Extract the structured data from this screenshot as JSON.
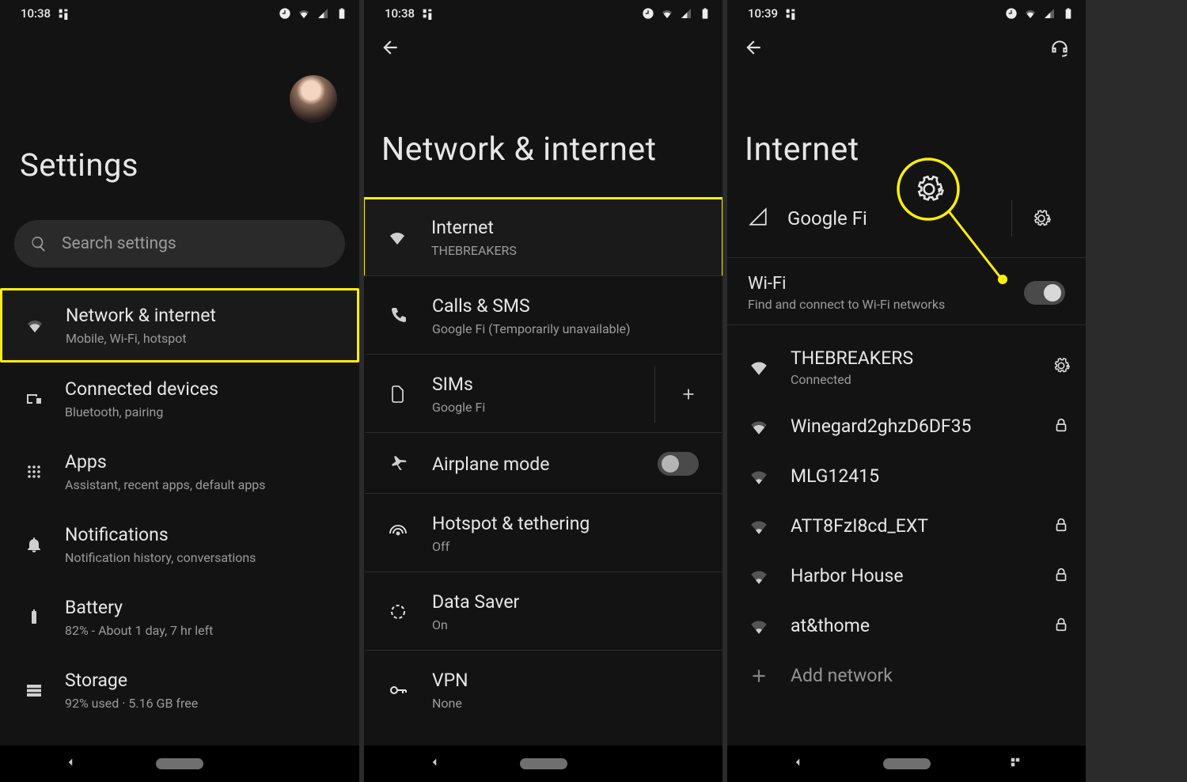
{
  "statusbar1": {
    "time": "10:38"
  },
  "statusbar2": {
    "time": "10:38"
  },
  "statusbar3": {
    "time": "10:39"
  },
  "panel1": {
    "title": "Settings",
    "search_placeholder": "Search settings",
    "items": [
      {
        "title": "Network & internet",
        "sub": "Mobile, Wi-Fi, hotspot"
      },
      {
        "title": "Connected devices",
        "sub": "Bluetooth, pairing"
      },
      {
        "title": "Apps",
        "sub": "Assistant, recent apps, default apps"
      },
      {
        "title": "Notifications",
        "sub": "Notification history, conversations"
      },
      {
        "title": "Battery",
        "sub": "82% - About 1 day, 7 hr left"
      },
      {
        "title": "Storage",
        "sub": "92% used · 5.16 GB free"
      }
    ]
  },
  "panel2": {
    "title": "Network & internet",
    "items": [
      {
        "title": "Internet",
        "sub": "THEBREAKERS"
      },
      {
        "title": "Calls & SMS",
        "sub": "Google Fi (Temporarily unavailable)"
      },
      {
        "title": "SIMs",
        "sub": "Google Fi"
      },
      {
        "title": "Airplane mode",
        "sub": ""
      },
      {
        "title": "Hotspot & tethering",
        "sub": "Off"
      },
      {
        "title": "Data Saver",
        "sub": "On"
      },
      {
        "title": "VPN",
        "sub": "None"
      }
    ]
  },
  "panel3": {
    "title": "Internet",
    "carrier": "Google Fi",
    "wifi_title": "Wi-Fi",
    "wifi_sub": "Find and connect to Wi-Fi networks",
    "networks": [
      {
        "name": "THEBREAKERS",
        "sub": "Connected",
        "action": "gear"
      },
      {
        "name": "Winegard2ghzD6DF35",
        "sub": "",
        "action": "lock"
      },
      {
        "name": "MLG12415",
        "sub": "",
        "action": ""
      },
      {
        "name": "ATT8FzI8cd_EXT",
        "sub": "",
        "action": "lock"
      },
      {
        "name": "Harbor House",
        "sub": "",
        "action": "lock"
      },
      {
        "name": "at&thome",
        "sub": "",
        "action": "lock"
      }
    ],
    "add_network": "Add network"
  }
}
